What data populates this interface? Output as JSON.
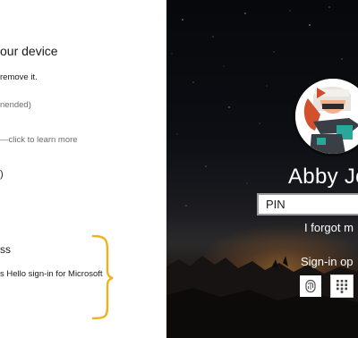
{
  "settings": {
    "heading": "our device",
    "remove_line": "remove it.",
    "recommended_line": "nended)",
    "learn_more_line": "—click to learn more",
    "fragment_paren": ")",
    "section_title": "ss",
    "hello_line": "s Hello sign-in for Microsoft"
  },
  "lock_screen": {
    "username": "Abby Jo",
    "pin_placeholder": "PIN",
    "forgot_link": "I forgot m",
    "signin_options_label": "Sign-in op",
    "option_icons": [
      "fingerprint-icon",
      "pin-keypad-icon"
    ]
  },
  "colors": {
    "annotation_bracket": "#f0b21a",
    "lock_text": "#ffffff"
  }
}
